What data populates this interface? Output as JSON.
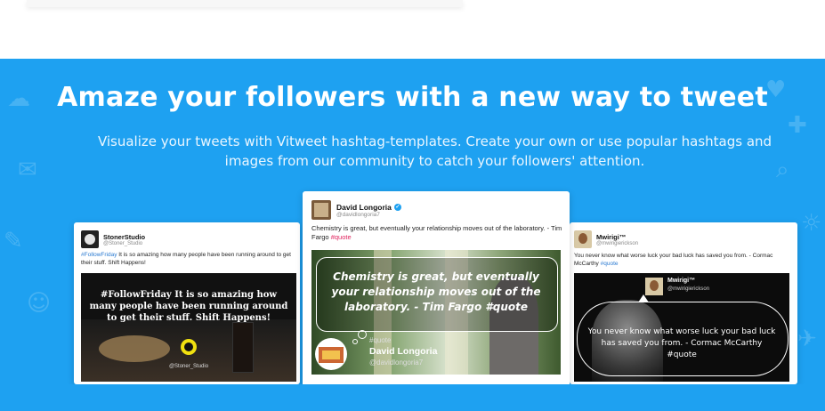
{
  "hero": {
    "headline": "Amaze your followers with a new way to tweet",
    "subline": "Visualize your tweets with Vitweet hashtag-templates. Create your own or use popular hashtags and images from our community to catch your followers' attention."
  },
  "cards": {
    "left": {
      "name": "StonerStudio",
      "handle": "@Stoner_Studio",
      "hashtag": "#FollowFriday",
      "text": " It is so amazing how many people have been running around to get their stuff. Shift Happens!",
      "image_text": "#FollowFriday It is so amazing how many people have been running around to get their stuff. Shift Happens!",
      "image_handle": "@Stoner_Studio"
    },
    "middle": {
      "name": "David Longoria",
      "handle": "@davidlongoria7",
      "text": "Chemistry is great, but eventually your relationship moves out of the laboratory. - Tim Fargo ",
      "hashtag": "#quote",
      "image_quote": "Chemistry is great, but eventually your relationship moves out of the laboratory. - Tim Fargo #quote",
      "image_tag": "#quote",
      "image_name": "David Longoria",
      "image_handle": "@davidlongoria7"
    },
    "right": {
      "name": "Mwirigi™",
      "handle": "@mwirigierickson",
      "text": "You never know what worse luck your bad luck has saved you from. - Cormac McCarthy ",
      "hashtag": "#quote",
      "image_name": "Mwirigi™",
      "image_handle": "@mwirigierickson",
      "image_quote": "You never know what worse luck your bad luck has saved you from. - Cormac McCarthy #quote"
    }
  },
  "colors": {
    "brand": "#1ea1f1",
    "hashtag": "#2a7ad1",
    "hashtag_alt": "#e0245e"
  }
}
